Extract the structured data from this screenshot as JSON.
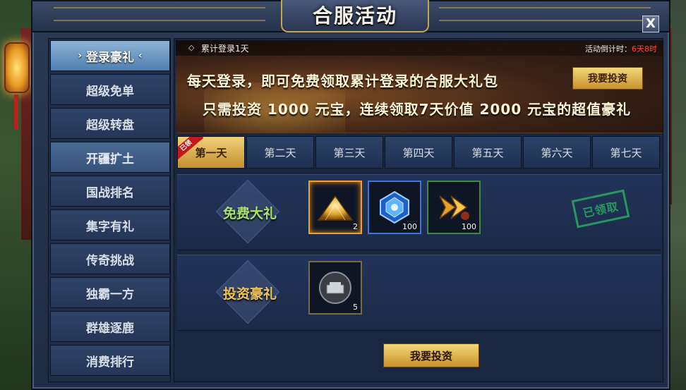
{
  "window": {
    "title": "合服活动",
    "close_label": "X"
  },
  "sidebar": {
    "items": [
      {
        "label": "登录豪礼"
      },
      {
        "label": "超级免单"
      },
      {
        "label": "超级转盘"
      },
      {
        "label": "开疆扩土"
      },
      {
        "label": "国战排名"
      },
      {
        "label": "集字有礼"
      },
      {
        "label": "传奇挑战"
      },
      {
        "label": "独霸一方"
      },
      {
        "label": "群雄逐鹿"
      },
      {
        "label": "消费排行"
      }
    ]
  },
  "banner": {
    "subtitle": "累计登录1天",
    "countdown_label": "活动倒计时：",
    "countdown_value": "6天8时",
    "line1": "每天登录，即可免费领取累计登录的合服大礼包",
    "line2": "只需投资 1000 元宝，连续领取7天价值 2000 元宝的超值豪礼",
    "invest_label": "我要投资"
  },
  "tabs": {
    "claimed_ribbon": "已领",
    "items": [
      {
        "label": "第一天"
      },
      {
        "label": "第二天"
      },
      {
        "label": "第三天"
      },
      {
        "label": "第四天"
      },
      {
        "label": "第五天"
      },
      {
        "label": "第六天"
      },
      {
        "label": "第七天"
      }
    ]
  },
  "rows": {
    "free": {
      "label": "免费大礼",
      "stamp": "已领取",
      "items": [
        {
          "icon": "gold-pile-icon",
          "count": "2"
        },
        {
          "icon": "blue-gem-icon",
          "count": "100"
        },
        {
          "icon": "golden-arrow-icon",
          "count": "100"
        }
      ]
    },
    "invest": {
      "label": "投资豪礼",
      "items": [
        {
          "icon": "locked-chest-icon",
          "count": "5"
        }
      ]
    }
  },
  "footer": {
    "invest_label": "我要投资"
  },
  "colors": {
    "accent_gold": "#c9922c",
    "free_label": "#a7e26a",
    "invest_label": "#f0c35a",
    "countdown_red": "#ff4a3a",
    "stamp_green": "#2aa260"
  }
}
